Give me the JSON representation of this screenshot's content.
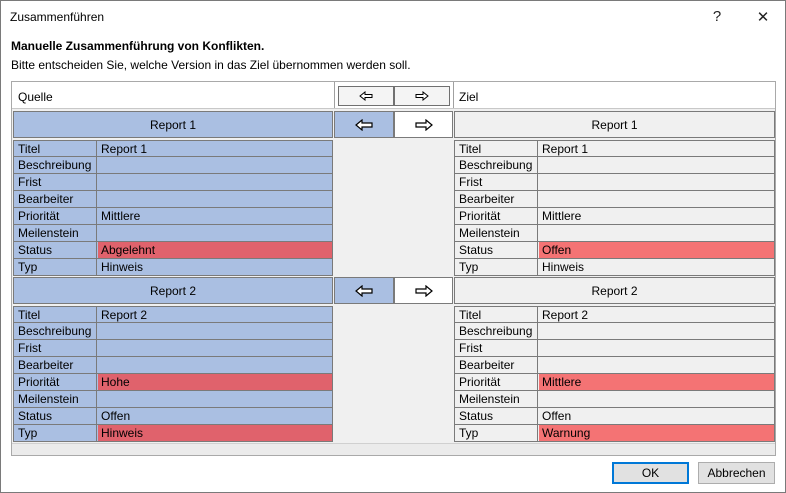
{
  "window": {
    "title": "Zusammenführen",
    "help_label": "?",
    "close_label": "✕"
  },
  "heading": "Manuelle Zusammenführung von Konflikten.",
  "subheading": "Bitte entscheiden Sie, welche Version in das Ziel übernommen werden soll.",
  "columns": {
    "source_label": "Quelle",
    "target_label": "Ziel"
  },
  "icons": {
    "arrow_left": "arrow-left-icon",
    "arrow_right": "arrow-right-icon"
  },
  "colors": {
    "source_bg": "#aabfe2",
    "conflict_source": "#e0626c",
    "conflict_target": "#f47374",
    "ok_border": "#0078d7"
  },
  "groups": [
    {
      "source_title": "Report 1",
      "target_title": "Report 1",
      "selected_direction": "left",
      "source_rows": [
        {
          "key": "Titel",
          "value": "Report 1",
          "conflict": false
        },
        {
          "key": "Beschreibung",
          "value": "",
          "conflict": false
        },
        {
          "key": "Frist",
          "value": "",
          "conflict": false
        },
        {
          "key": "Bearbeiter",
          "value": "",
          "conflict": false
        },
        {
          "key": "Priorität",
          "value": "Mittlere",
          "conflict": false
        },
        {
          "key": "Meilenstein",
          "value": "",
          "conflict": false
        },
        {
          "key": "Status",
          "value": "Abgelehnt",
          "conflict": true
        },
        {
          "key": "Typ",
          "value": "Hinweis",
          "conflict": false
        }
      ],
      "target_rows": [
        {
          "key": "Titel",
          "value": "Report 1",
          "conflict": false
        },
        {
          "key": "Beschreibung",
          "value": "",
          "conflict": false
        },
        {
          "key": "Frist",
          "value": "",
          "conflict": false
        },
        {
          "key": "Bearbeiter",
          "value": "",
          "conflict": false
        },
        {
          "key": "Priorität",
          "value": "Mittlere",
          "conflict": false
        },
        {
          "key": "Meilenstein",
          "value": "",
          "conflict": false
        },
        {
          "key": "Status",
          "value": "Offen",
          "conflict": true
        },
        {
          "key": "Typ",
          "value": "Hinweis",
          "conflict": false
        }
      ]
    },
    {
      "source_title": "Report 2",
      "target_title": "Report 2",
      "selected_direction": "left",
      "source_rows": [
        {
          "key": "Titel",
          "value": "Report 2",
          "conflict": false
        },
        {
          "key": "Beschreibung",
          "value": "",
          "conflict": false
        },
        {
          "key": "Frist",
          "value": "",
          "conflict": false
        },
        {
          "key": "Bearbeiter",
          "value": "",
          "conflict": false
        },
        {
          "key": "Priorität",
          "value": "Hohe",
          "conflict": true
        },
        {
          "key": "Meilenstein",
          "value": "",
          "conflict": false
        },
        {
          "key": "Status",
          "value": "Offen",
          "conflict": false
        },
        {
          "key": "Typ",
          "value": "Hinweis",
          "conflict": true
        }
      ],
      "target_rows": [
        {
          "key": "Titel",
          "value": "Report 2",
          "conflict": false
        },
        {
          "key": "Beschreibung",
          "value": "",
          "conflict": false
        },
        {
          "key": "Frist",
          "value": "",
          "conflict": false
        },
        {
          "key": "Bearbeiter",
          "value": "",
          "conflict": false
        },
        {
          "key": "Priorität",
          "value": "Mittlere",
          "conflict": true
        },
        {
          "key": "Meilenstein",
          "value": "",
          "conflict": false
        },
        {
          "key": "Status",
          "value": "Offen",
          "conflict": false
        },
        {
          "key": "Typ",
          "value": "Warnung",
          "conflict": true
        }
      ]
    }
  ],
  "footer": {
    "ok_label": "OK",
    "cancel_label": "Abbrechen"
  }
}
